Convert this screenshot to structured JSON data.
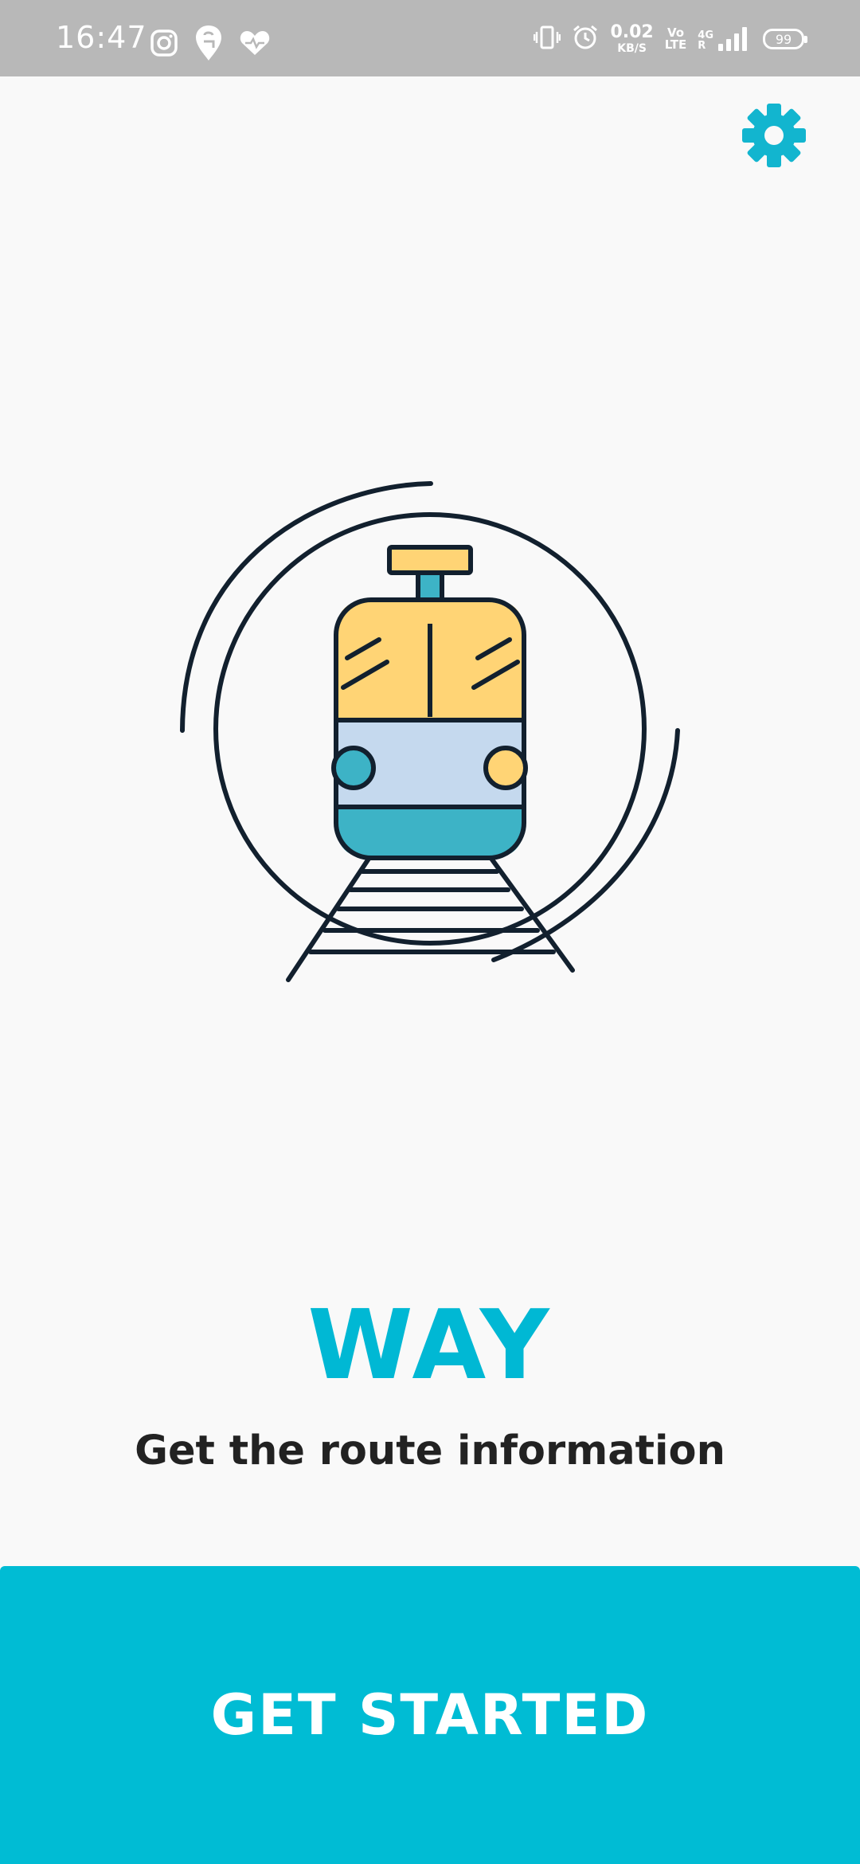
{
  "status_bar": {
    "time": "16:47",
    "net_speed_value": "0.02",
    "net_speed_unit": "KB/S",
    "volte_top": "Vo",
    "volte_bottom": "LTE",
    "network_type": "4G",
    "roaming": "R",
    "battery": "99",
    "icons": [
      "instagram-icon",
      "swiggy-icon",
      "health-heart-icon",
      "vibrate-icon",
      "alarm-icon",
      "signal-icon",
      "battery-icon"
    ]
  },
  "header": {
    "settings_icon": "gear-icon"
  },
  "hero": {
    "illustration": "train-icon"
  },
  "branding": {
    "title": "WAY",
    "tagline": "Get the route information"
  },
  "actions": {
    "primary_label": "GET STARTED"
  },
  "colors": {
    "accent": "#00bcd4",
    "title": "#00b8d4",
    "status_bar": "#b8b8b8",
    "train_top": "#ffd475",
    "train_middle": "#c5d9ee",
    "train_bottom": "#3db3c6",
    "outline": "#12202e"
  }
}
